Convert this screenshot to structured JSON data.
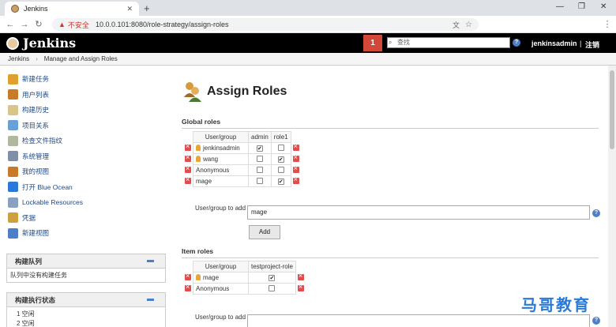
{
  "browser": {
    "tab_title": "Jenkins",
    "address_security": "不安全",
    "address_url": "10.0.0.101:8080/role-strategy/assign-roles"
  },
  "header": {
    "logo_text": "Jenkins",
    "notification_count": "1",
    "search_placeholder": "查找",
    "username": "jenkinsadmin",
    "separator": "|",
    "logout_label": "注销"
  },
  "breadcrumb": [
    "Jenkins",
    "Manage and Assign Roles"
  ],
  "sidebar": {
    "tasks": [
      {
        "label": "新建任务",
        "icon": "new-item-icon",
        "color": "#e0a030"
      },
      {
        "label": "用户列表",
        "icon": "people-icon",
        "color": "#c87a2a"
      },
      {
        "label": "构建历史",
        "icon": "notepad-icon",
        "color": "#d9c48a"
      },
      {
        "label": "项目关系",
        "icon": "search-icon",
        "color": "#6aa0d8"
      },
      {
        "label": "检查文件指纹",
        "icon": "fingerprint-icon",
        "color": "#b0b8a0"
      },
      {
        "label": "系统管理",
        "icon": "gear-icon",
        "color": "#7f8fa8"
      },
      {
        "label": "我的视图",
        "icon": "people-icon",
        "color": "#c87a2a"
      },
      {
        "label": "打开 Blue Ocean",
        "icon": "blue-ocean-icon",
        "color": "#2b78d8"
      },
      {
        "label": "Lockable Resources",
        "icon": "lock-icon",
        "color": "#8aa0c0"
      },
      {
        "label": "凭据",
        "icon": "credentials-icon",
        "color": "#d0a040"
      },
      {
        "label": "新建视图",
        "icon": "folder-icon",
        "color": "#4d7fc8"
      }
    ],
    "build_queue": {
      "title": "构建队列",
      "empty_text": "队列中没有构建任务"
    },
    "executors": {
      "title": "构建执行状态",
      "rows": [
        "1  空闲",
        "2  空闲"
      ]
    }
  },
  "main": {
    "title": "Assign Roles",
    "global_roles": {
      "section_title": "Global roles",
      "headers": [
        "User/group",
        "admin",
        "role1"
      ],
      "rows": [
        {
          "name": "jenkinsadmin",
          "is_user": true,
          "checks": [
            true,
            false
          ]
        },
        {
          "name": "wang",
          "is_user": true,
          "checks": [
            false,
            true
          ]
        },
        {
          "name": "Anonymous",
          "is_user": false,
          "checks": [
            false,
            false
          ]
        },
        {
          "name": "mage",
          "is_user": false,
          "checks": [
            false,
            true
          ]
        }
      ],
      "add_label": "User/group to add",
      "add_value": "mage",
      "add_button": "Add"
    },
    "item_roles": {
      "section_title": "Item roles",
      "headers": [
        "User/group",
        "testproject-role"
      ],
      "rows": [
        {
          "name": "mage",
          "is_user": true,
          "checks": [
            true
          ]
        },
        {
          "name": "Anonymous",
          "is_user": false,
          "checks": [
            false
          ]
        }
      ],
      "add_label": "User/group to add",
      "add_value": ""
    }
  },
  "watermark": "马哥教育"
}
